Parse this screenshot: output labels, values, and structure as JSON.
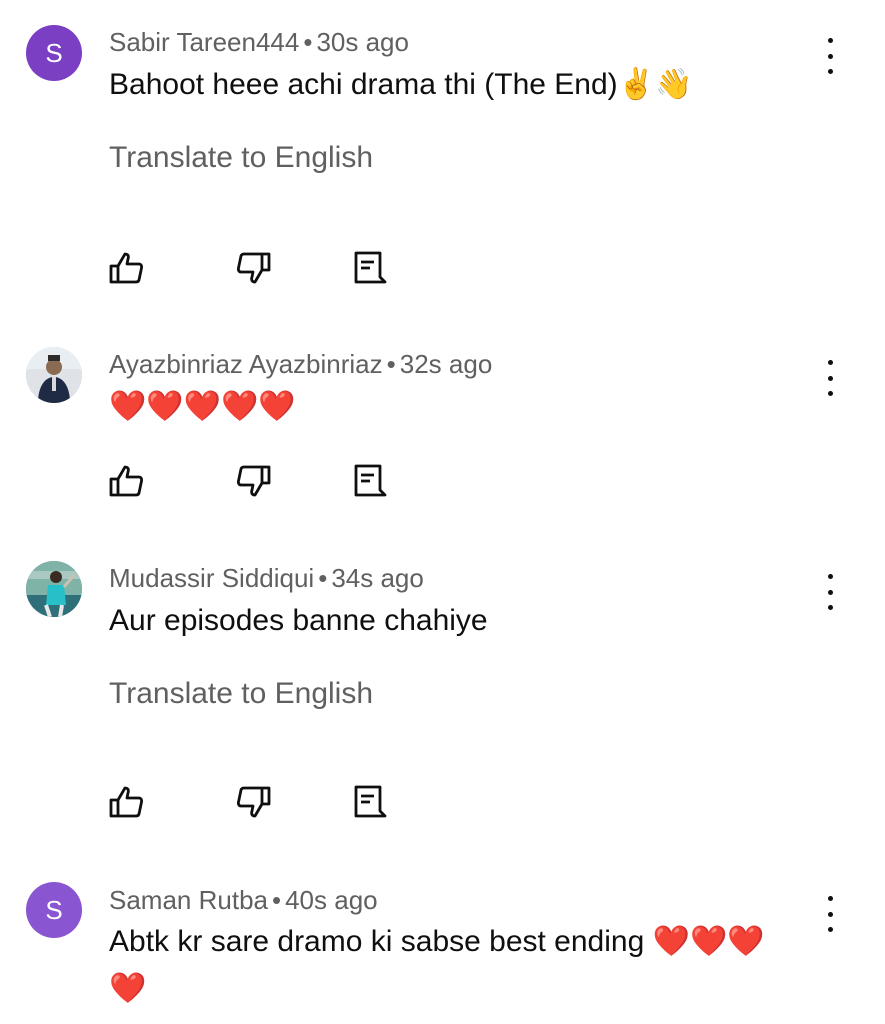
{
  "comments": [
    {
      "author": "Sabir Tareen444",
      "separator": "•",
      "time": "30s ago",
      "avatar_letter": "S",
      "text": "Bahoot heee achi drama thi (The End)✌️👋",
      "translate": "Translate to English"
    },
    {
      "author": "Ayazbinriaz Ayazbinriaz",
      "separator": "•",
      "time": "32s ago",
      "avatar_letter": "",
      "text": "❤️❤️❤️❤️❤️"
    },
    {
      "author": "Mudassir Siddiqui",
      "separator": "•",
      "time": "34s ago",
      "avatar_letter": "",
      "text": "Aur episodes banne chahiye",
      "translate": "Translate to English"
    },
    {
      "author": "Saman Rutba",
      "separator": "•",
      "time": "40s ago",
      "avatar_letter": "S",
      "text_line1": "Abtk kr sare dramo ki sabse best ending ❤️❤️❤️",
      "text_line2": "❤️"
    }
  ],
  "icons": {
    "like": "thumbs-up-icon",
    "dislike": "thumbs-down-icon",
    "reply": "reply-comment-icon",
    "more": "more-vertical-icon"
  },
  "colors": {
    "avatar_purple": "#7b3fc4",
    "meta_gray": "#606060",
    "text": "#0f0f0f"
  }
}
